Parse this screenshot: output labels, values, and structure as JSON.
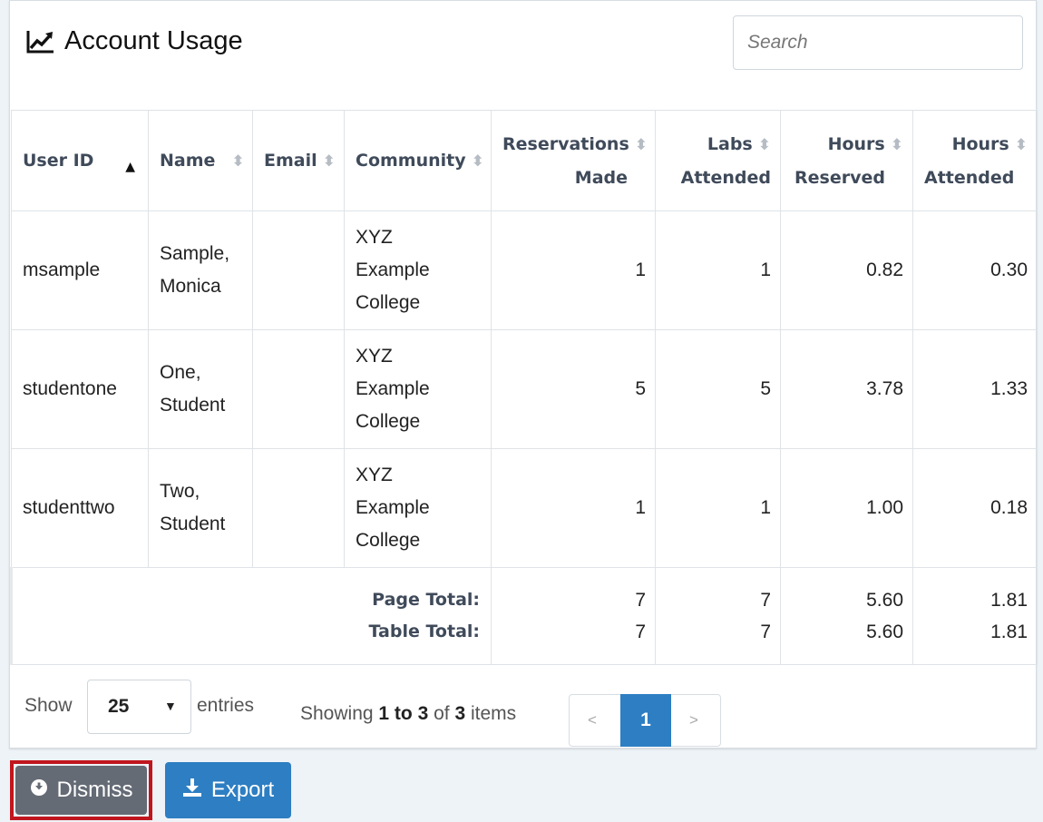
{
  "header": {
    "title": "Account Usage",
    "title_icon": "line-chart-icon",
    "search_placeholder": "Search"
  },
  "table": {
    "columns": [
      {
        "label_1": "User ID",
        "label_2": ""
      },
      {
        "label_1": "Name",
        "label_2": ""
      },
      {
        "label_1": "Email",
        "label_2": ""
      },
      {
        "label_1": "Community",
        "label_2": ""
      },
      {
        "label_1": "Reservations",
        "label_2": "Made"
      },
      {
        "label_1": "Labs",
        "label_2": "Attended"
      },
      {
        "label_1": "Hours",
        "label_2": "Reserved"
      },
      {
        "label_1": "Hours",
        "label_2": "Attended"
      }
    ],
    "sorted_column": "User ID",
    "rows": [
      {
        "user_id": "msample",
        "name_1": "Sample,",
        "name_2": "Monica",
        "email": "",
        "community_1": "XYZ",
        "community_2": "Example",
        "community_3": "College",
        "reservations": "1",
        "labs": "1",
        "hours_reserved": "0.82",
        "hours_attended": "0.30"
      },
      {
        "user_id": "studentone",
        "name_1": "One,",
        "name_2": "Student",
        "email": "",
        "community_1": "XYZ",
        "community_2": "Example",
        "community_3": "College",
        "reservations": "5",
        "labs": "5",
        "hours_reserved": "3.78",
        "hours_attended": "1.33"
      },
      {
        "user_id": "studenttwo",
        "name_1": "Two,",
        "name_2": "Student",
        "email": "",
        "community_1": "XYZ",
        "community_2": "Example",
        "community_3": "College",
        "reservations": "1",
        "labs": "1",
        "hours_reserved": "1.00",
        "hours_attended": "0.18"
      }
    ],
    "totals": {
      "page_label": "Page Total:",
      "table_label": "Table Total:",
      "page": {
        "reservations": "7",
        "labs": "7",
        "hours_reserved": "5.60",
        "hours_attended": "1.81"
      },
      "table": {
        "reservations": "7",
        "labs": "7",
        "hours_reserved": "5.60",
        "hours_attended": "1.81"
      }
    }
  },
  "footer": {
    "show_label": "Show",
    "entries_value": "25",
    "entries_label": "entries",
    "info_prefix": "Showing",
    "info_range": "1 to 3",
    "info_of": "of",
    "info_total": "3",
    "info_suffix": "items",
    "pager_prev": "<",
    "pager_current": "1",
    "pager_next": ">"
  },
  "actions": {
    "dismiss_label": "Dismiss",
    "export_label": "Export"
  },
  "colors": {
    "primary": "#2d7ec2",
    "dismiss_bg": "#646b75",
    "highlight_border": "#c0161e"
  }
}
